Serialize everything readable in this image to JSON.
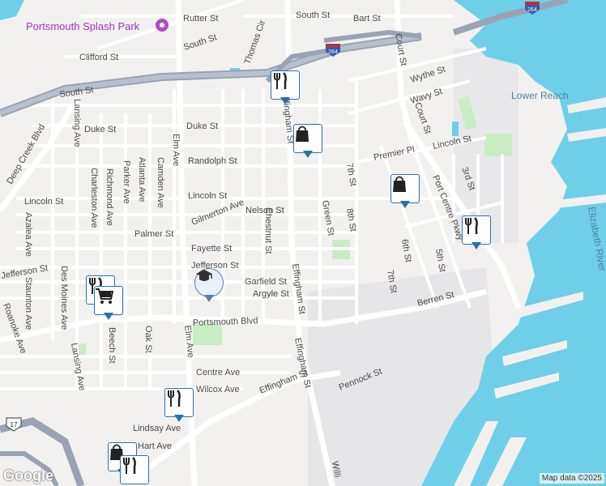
{
  "map": {
    "attribution": "Map data ©2025",
    "logo": "Google",
    "colors": {
      "water": "#6fcfe8",
      "land": "#f2f1ef",
      "park": "#c9ecc4",
      "road": "#ffffff",
      "highway": "#98a4b4",
      "poi_pin": "#2a6fb0"
    }
  },
  "labels": {
    "splash_park": "Portsmouth Splash Park",
    "rutter": "Rutter St",
    "south_top": "South St",
    "bart": "Bart St",
    "south_diag": "South St",
    "clifford": "Clifford St",
    "thomas_cir": "Thomas Cir",
    "south_left": "South St",
    "court_top": "Court St",
    "wythe": "Wythe St",
    "wavy": "Wavy St",
    "lower_reach": "Lower Reach",
    "duke": "Duke St",
    "deep_creek": "Deep Creek Blvd",
    "randolph": "Randolph St",
    "premier": "Premier Pl",
    "lincoln_right": "Lincoln St",
    "court_mid": "Court St",
    "seventh_a": "7th St",
    "third": "3rd St",
    "lansing": "Lansing Ave",
    "charleston": "Charleston Ave",
    "richmond": "Richmond Ave",
    "parker": "Parker Ave",
    "atlanta": "Atlanta Ave",
    "camden": "Camden Ave",
    "elm": "Elm Ave",
    "lincoln_left": "Lincoln St",
    "lincoln_mid": "Lincoln St",
    "effingham_top": "Effingham St",
    "green": "Green St",
    "gilmerton": "Gilmerton Ave",
    "nelson": "Nelson St",
    "port_centre": "Port Centre Pkwy",
    "elizabeth": "Elizabeth River",
    "azalea": "Azalea Ave",
    "des_moines": "Des Moines Ave",
    "palmer": "Palmer St",
    "chestnut": "Chestnut St",
    "eighth": "8th St",
    "sixth": "6th St",
    "fifth": "5th St",
    "jefferson_left": "Jefferson St",
    "fayette": "Fayette St",
    "jefferson_mid": "Jefferson St",
    "staunton": "Staunton Ave",
    "garfield": "Garfield St",
    "effingham_mid": "Effingham St",
    "seventh_b": "7th St",
    "roanoke": "Roanoke Ave",
    "argyle": "Argyle St",
    "berren": "Berren St",
    "portsmouth_blvd": "Portsmouth Blvd",
    "beech": "Beech St",
    "oak": "Oak St",
    "elm_low": "Elm Ave",
    "lansing_low": "Lansing Ave",
    "effingham_low": "Effingham St",
    "pennock": "Pennock St",
    "centre": "Centre Ave",
    "wilcox": "Wilcox Ave",
    "lindsay": "Lindsay Ave",
    "hart": "Hart Ave",
    "willi": "Willi",
    "shield_264_top": "264",
    "shield_264_mid": "264",
    "shield_17": "17"
  },
  "pins": [
    {
      "icon": "restaurant-icon"
    },
    {
      "icon": "shopping-bag-icon"
    },
    {
      "icon": "shopping-bag-icon"
    },
    {
      "icon": "restaurant-icon"
    },
    {
      "icon": "restaurant-icon"
    },
    {
      "icon": "shopping-cart-icon"
    },
    {
      "icon": "school-icon"
    },
    {
      "icon": "restaurant-icon"
    },
    {
      "icon": "shopping-bag-icon"
    },
    {
      "icon": "restaurant-icon"
    }
  ]
}
